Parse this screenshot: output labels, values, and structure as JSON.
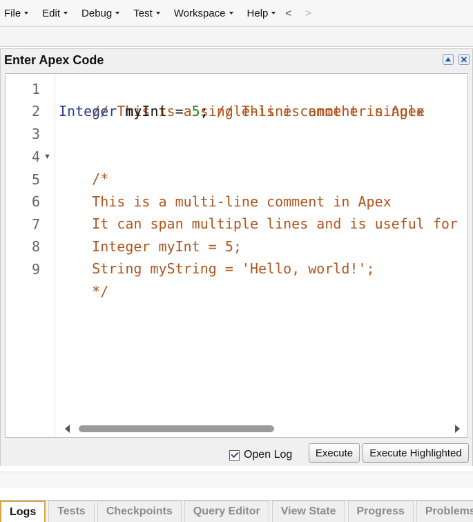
{
  "menu": {
    "items": [
      {
        "label": "File"
      },
      {
        "label": "Edit"
      },
      {
        "label": "Debug"
      },
      {
        "label": "Test"
      },
      {
        "label": "Workspace"
      },
      {
        "label": "Help"
      }
    ],
    "back": "<",
    "forward": ">"
  },
  "panel": {
    "title": "Enter Apex Code"
  },
  "editor": {
    "line_numbers": [
      "1",
      "2",
      "3",
      "4",
      "5",
      "6",
      "7",
      "8",
      "9"
    ],
    "lines": {
      "l1": "// This is a single-line comment in Apex",
      "l2_type": "Integer",
      "l2_plain": " myInt = ",
      "l2_num": "5",
      "l2_semi": ";",
      "l2_comment": " // This is another single",
      "l4": "/*",
      "l5": "This is a multi-line comment in Apex",
      "l6": "It can span multiple lines and is useful for",
      "l7": "Integer myInt = 5;",
      "l8": "String myString = 'Hello, world!';",
      "l9": "*/"
    }
  },
  "footer": {
    "open_log_label": "Open Log",
    "open_log_checked": true,
    "execute_label": "Execute",
    "execute_highlighted_label": "Execute Highlighted"
  },
  "tabs": [
    {
      "label": "Logs",
      "active": true
    },
    {
      "label": "Tests"
    },
    {
      "label": "Checkpoints"
    },
    {
      "label": "Query Editor"
    },
    {
      "label": "View State"
    },
    {
      "label": "Progress"
    },
    {
      "label": "Problems"
    }
  ],
  "colors": {
    "comment": "#b2551d",
    "keyword_type": "#2a3f94",
    "number": "#1d7d23",
    "active_tab_border": "#e1a23d"
  }
}
